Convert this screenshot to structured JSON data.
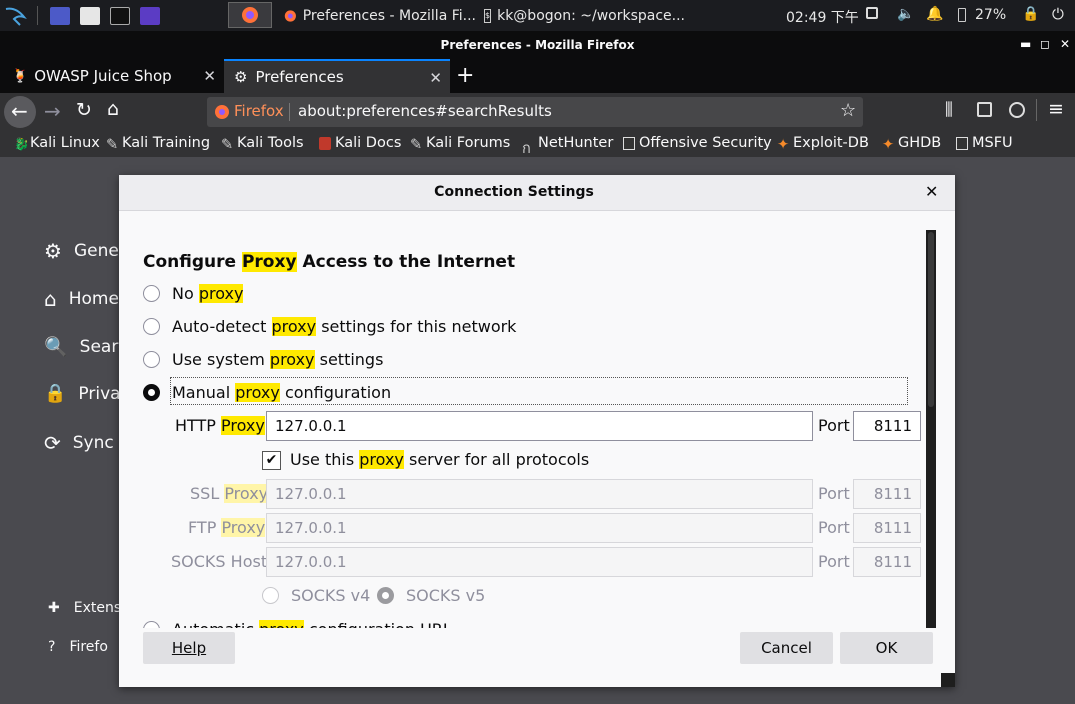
{
  "taskbar": {
    "tasks": [
      {
        "label": "Preferences - Mozilla Fi..."
      },
      {
        "label": "kk@bogon: ~/workspace..."
      }
    ],
    "clock": "02:49 下午",
    "battery": "27%"
  },
  "window": {
    "title": "Preferences - Mozilla Firefox"
  },
  "tabs": [
    {
      "label": "OWASP Juice Shop"
    },
    {
      "label": "Preferences"
    }
  ],
  "urlbar": {
    "identity": "Firefox",
    "url": "about:preferences#searchResults"
  },
  "bookmarks": [
    {
      "label": "Kali Linux"
    },
    {
      "label": "Kali Training"
    },
    {
      "label": "Kali Tools"
    },
    {
      "label": "Kali Docs"
    },
    {
      "label": "Kali Forums"
    },
    {
      "label": "NetHunter"
    },
    {
      "label": "Offensive Security"
    },
    {
      "label": "Exploit-DB"
    },
    {
      "label": "GHDB"
    },
    {
      "label": "MSFU"
    }
  ],
  "sidebar": {
    "items": [
      {
        "label": "Gene"
      },
      {
        "label": "Home"
      },
      {
        "label": "Searc"
      },
      {
        "label": "Priva"
      },
      {
        "label": "Sync"
      }
    ],
    "footer": [
      {
        "label": "Extens"
      },
      {
        "label": "Firefo"
      }
    ]
  },
  "dialog": {
    "title": "Connection Settings",
    "heading_pre": "Configure ",
    "heading_hl": "Proxy",
    "heading_post": " Access to the Internet",
    "hl_word": "proxy",
    "options": [
      {
        "pre": "No ",
        "post": ""
      },
      {
        "pre": "Auto-detect ",
        "post": " settings for this network"
      },
      {
        "pre": "Use system ",
        "post": " settings"
      },
      {
        "pre": "Manual ",
        "post": " configuration"
      }
    ],
    "selected": "Manual proxy configuration",
    "http": {
      "label_pre": "HTTP ",
      "label_hl": "Proxy",
      "value": "127.0.0.1",
      "port_label": "Port",
      "port": "8111"
    },
    "use_all": {
      "pre": "Use this ",
      "post": " server for all protocols",
      "checked": true
    },
    "ssl": {
      "label_pre": "SSL ",
      "label_hl": "Proxy",
      "value": "127.0.0.1",
      "port_label": "Port",
      "port": "8111"
    },
    "ftp": {
      "label_pre": "FTP ",
      "label_hl": "Proxy",
      "value": "127.0.0.1",
      "port_label": "Port",
      "port": "8111"
    },
    "socks": {
      "label": "SOCKS Host",
      "value": "127.0.0.1",
      "port_label": "Port",
      "port": "8111"
    },
    "socks_v4": "SOCKS v4",
    "socks_v5": "SOCKS v5",
    "cut_pre": "Automatic ",
    "cut_post": " configuration URL",
    "buttons": {
      "help": "Help",
      "cancel": "Cancel",
      "ok": "OK"
    }
  }
}
